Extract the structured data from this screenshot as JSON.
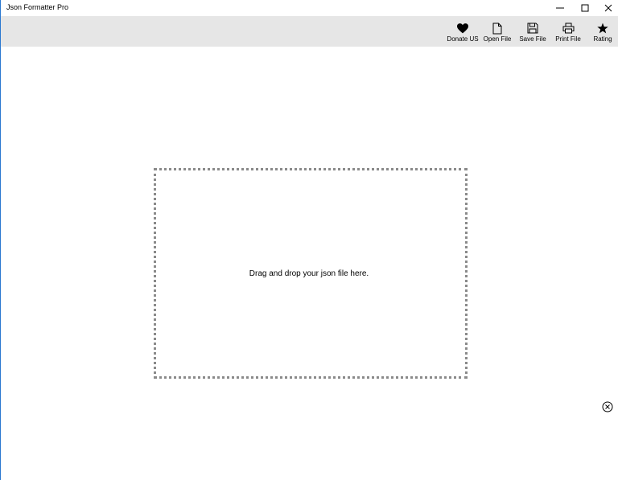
{
  "window": {
    "title": "Json Formatter Pro"
  },
  "titlebar_buttons": {
    "minimize_icon": "minimize-icon",
    "maximize_icon": "maximize-icon",
    "close_icon": "close-icon"
  },
  "commandbar": {
    "items": [
      {
        "label": "Donate US",
        "icon": "heart-icon"
      },
      {
        "label": "Open File",
        "icon": "new-file-icon"
      },
      {
        "label": "Save File",
        "icon": "floppy-disk-icon"
      },
      {
        "label": "Print File",
        "icon": "printer-icon"
      },
      {
        "label": "Rating",
        "icon": "star-icon"
      }
    ]
  },
  "dropzone": {
    "text": "Drag and drop your json file here."
  },
  "dismiss": {
    "icon": "close-circle-icon"
  },
  "colors": {
    "commandbar_bg": "#e6e6e6",
    "dropzone_border": "#8a8a8a",
    "window_accent": "#2b79d0"
  }
}
